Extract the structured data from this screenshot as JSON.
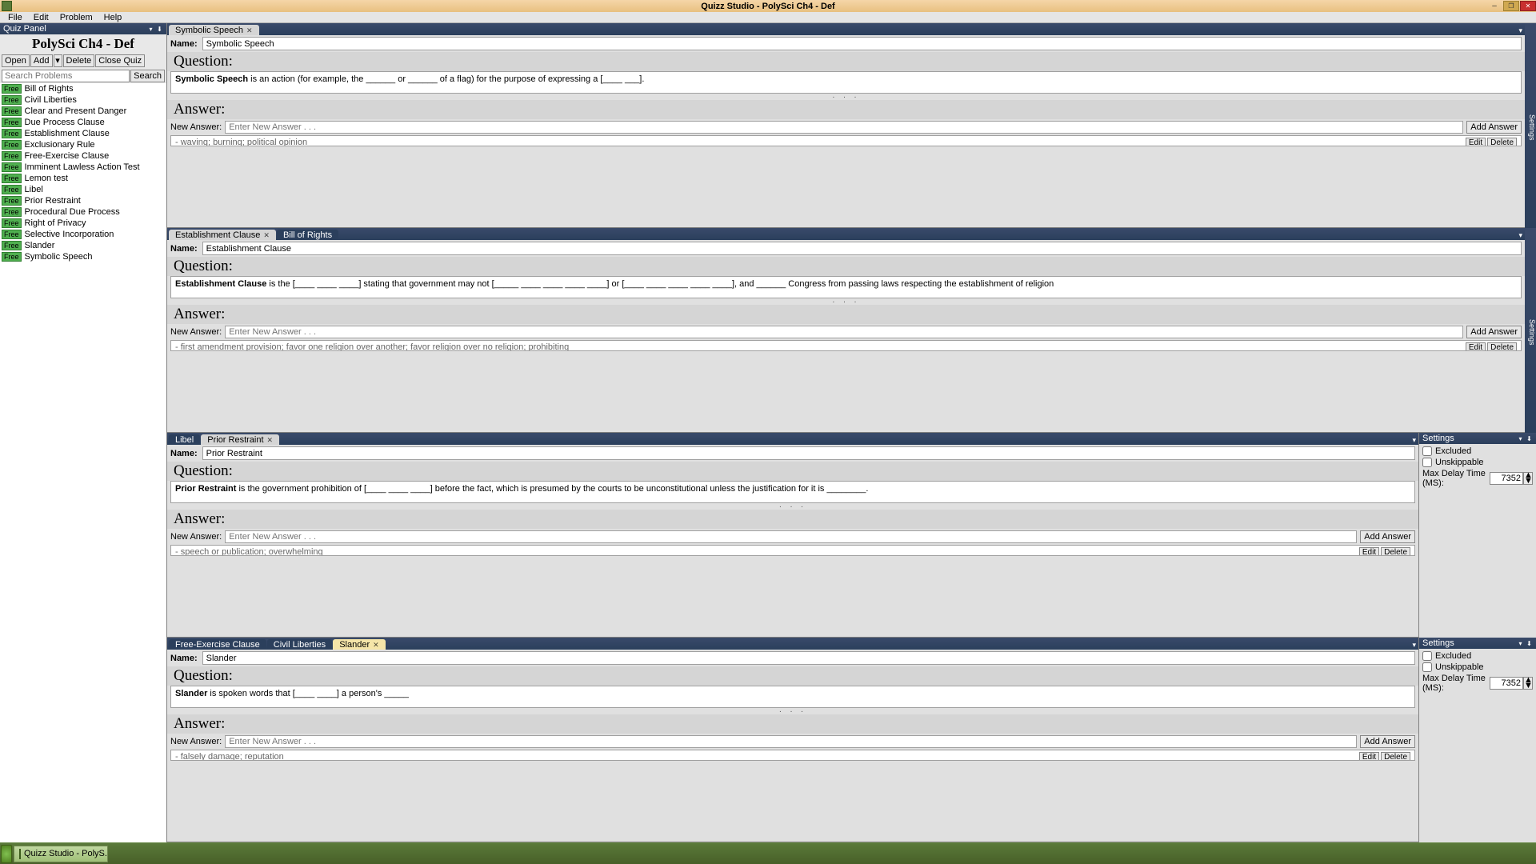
{
  "app": {
    "title": "Quizz Studio  - PolySci Ch4 - Def",
    "taskbar": "Quizz Studio  - PolyS..."
  },
  "menu": [
    "File",
    "Edit",
    "Problem",
    "Help"
  ],
  "quizPanel": {
    "header": "Quiz Panel",
    "title": "PolySci Ch4 - Def",
    "toolbar": {
      "open": "Open",
      "add": "Add",
      "delete": "Delete",
      "close": "Close Quiz"
    },
    "search": {
      "placeholder": "Search Problems",
      "button": "Search"
    },
    "itemTag": "Free",
    "items": [
      "Bill of Rights",
      "Civil Liberties",
      "Clear and Present Danger",
      "Due Process Clause",
      "Establishment Clause",
      "Exclusionary Rule",
      "Free-Exercise Clause",
      "Imminent Lawless Action Test",
      "Lemon test",
      "Libel",
      "Prior Restraint",
      "Procedural Due Process",
      "Right of Privacy",
      "Selective Incorporation",
      "Slander",
      "Symbolic Speech"
    ]
  },
  "labels": {
    "name": "Name:",
    "question": "Question:",
    "answer": "Answer:",
    "newAnswer": "New Answer:",
    "addAnswer": "Add Answer",
    "newAnswerPH": "Enter New Answer . . .",
    "edit": "Edit",
    "delete": "Delete",
    "settings": "Settings",
    "excluded": "Excluded",
    "unskippable": "Unskippable",
    "maxDelay": "Max Delay Time (MS):",
    "maxDelayVal": "7352"
  },
  "editors": [
    {
      "tabs": [
        {
          "label": "Symbolic Speech",
          "active": true
        }
      ],
      "name": "Symbolic Speech",
      "qBold": "Symbolic Speech",
      "qRest": " is an action (for example, the ______ or ______ of a flag) for the purpose of expressing a [____  ___].",
      "existing": "- waving; burning; political opinion",
      "settingsCollapsed": true
    },
    {
      "tabs": [
        {
          "label": "Establishment Clause",
          "active": true
        },
        {
          "label": "Bill of Rights"
        }
      ],
      "name": "Establishment Clause",
      "qBold": "Establishment Clause",
      "qRest": " is the [____  ____  ____] stating that government may not [_____  ____  ____  ____  ____] or [____  ____  ____  ____  ____], and ______ Congress from passing laws respecting the establishment of religion",
      "existing": "- first amendment provision; favor one religion over another; favor religion over no religion; prohibiting",
      "settingsCollapsed": true
    },
    {
      "tabs": [
        {
          "label": "Libel"
        },
        {
          "label": "Prior Restraint",
          "active": true
        }
      ],
      "name": "Prior Restraint",
      "qBold": "Prior Restraint",
      "qRest": " is the government prohibition of [____  ____  ____] before the fact, which is presumed by the courts to be unconstitutional unless the justification for it is ________.",
      "existing": "- speech or publication; overwhelming",
      "settingsOpen": true
    },
    {
      "tabs": [
        {
          "label": "Free-Exercise Clause"
        },
        {
          "label": "Civil Liberties"
        },
        {
          "label": "Slander",
          "active": true,
          "highlight": true
        }
      ],
      "name": "Slander",
      "qBold": "Slander",
      "qRest": " is spoken words that [____  ____] a person's _____",
      "existing": "- falsely damage; reputation",
      "settingsOpen": true
    }
  ]
}
